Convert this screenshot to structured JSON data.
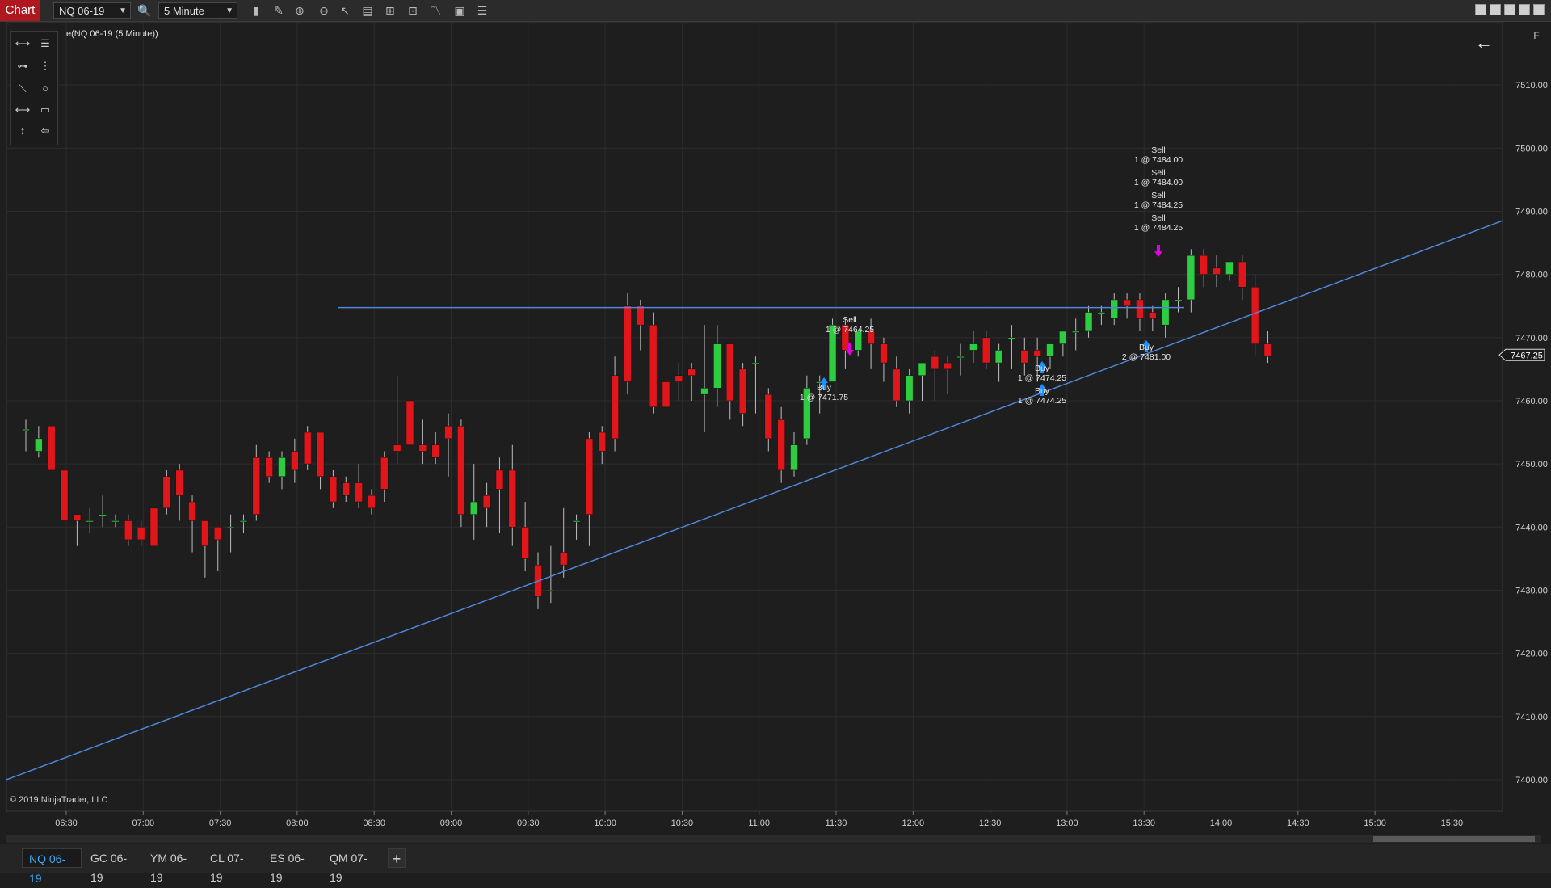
{
  "toolbar": {
    "chart_label": "Chart",
    "instrument": "NQ 06-19",
    "interval": "5 Minute",
    "icons": [
      "search-icon",
      "bars-icon",
      "pencil-icon",
      "zoom-in-icon",
      "zoom-out-icon",
      "pointer-icon",
      "data-box-icon",
      "properties-icon",
      "indicators-icon",
      "strategies-icon",
      "templates-icon",
      "list-icon"
    ]
  },
  "chart": {
    "title": "e(NQ 06-19 (5 Minute))",
    "copyright": "© 2019 NinjaTrader, LLC",
    "last_price_label": "7467.25",
    "f_label": "F"
  },
  "chart_data": {
    "type": "candlestick",
    "ylim": [
      7395,
      7520
    ],
    "yticks": [
      "7400.00",
      "7410.00",
      "7420.00",
      "7430.00",
      "7440.00",
      "7450.00",
      "7460.00",
      "7470.00",
      "7480.00",
      "7490.00",
      "7500.00",
      "7510.00"
    ],
    "yticks_values": [
      7400,
      7410,
      7420,
      7430,
      7440,
      7450,
      7460,
      7470,
      7480,
      7490,
      7500,
      7510
    ],
    "xticks": [
      "06:30",
      "07:00",
      "07:30",
      "08:00",
      "08:30",
      "09:00",
      "09:30",
      "10:00",
      "10:30",
      "11:00",
      "11:30",
      "12:00",
      "12:30",
      "13:00",
      "13:30",
      "14:00",
      "14:30",
      "15:00",
      "15:30"
    ],
    "bars": [
      [
        7455.5,
        7457,
        7455.5,
        7452
      ],
      [
        7452,
        7456,
        7454,
        7451
      ],
      [
        7456,
        7456,
        7449,
        7451
      ],
      [
        7449,
        7449,
        7441,
        7442
      ],
      [
        7442,
        7442,
        7441,
        7437
      ],
      [
        7441,
        7443,
        7441,
        7439
      ],
      [
        7442,
        7445,
        7442,
        7440
      ],
      [
        7441,
        7442,
        7441,
        7440
      ],
      [
        7441,
        7442,
        7438,
        7437
      ],
      [
        7440,
        7441,
        7438,
        7437
      ],
      [
        7443,
        7443,
        7437,
        7437
      ],
      [
        7448,
        7449,
        7443,
        7442
      ],
      [
        7449,
        7450,
        7445,
        7441
      ],
      [
        7444,
        7445,
        7441,
        7436
      ],
      [
        7441,
        7441,
        7437,
        7432
      ],
      [
        7440,
        7440,
        7438,
        7433
      ],
      [
        7440,
        7442,
        7440,
        7436
      ],
      [
        7441,
        7442,
        7441,
        7439
      ],
      [
        7451,
        7453,
        7442,
        7441
      ],
      [
        7451,
        7452,
        7448,
        7447
      ],
      [
        7448,
        7452,
        7451,
        7446
      ],
      [
        7452,
        7454,
        7449,
        7447
      ],
      [
        7455,
        7456,
        7450,
        7449
      ],
      [
        7455,
        7455,
        7448,
        7446
      ],
      [
        7448,
        7449,
        7444,
        7443
      ],
      [
        7447,
        7448,
        7445,
        7444
      ],
      [
        7447,
        7450,
        7444,
        7443
      ],
      [
        7445,
        7446,
        7443,
        7442
      ],
      [
        7451,
        7452,
        7446,
        7444
      ],
      [
        7453,
        7464,
        7452,
        7450
      ],
      [
        7460,
        7465,
        7453,
        7449
      ],
      [
        7453,
        7457,
        7452,
        7450
      ],
      [
        7453,
        7455,
        7451,
        7450
      ],
      [
        7456,
        7458,
        7454,
        7448
      ],
      [
        7456,
        7457,
        7442,
        7440
      ],
      [
        7442,
        7450,
        7444,
        7438
      ],
      [
        7445,
        7447,
        7443,
        7440
      ],
      [
        7449,
        7451,
        7446,
        7439
      ],
      [
        7449,
        7453,
        7440,
        7437
      ],
      [
        7440,
        7444,
        7435,
        7433
      ],
      [
        7434,
        7436,
        7429,
        7427
      ],
      [
        7430,
        7437,
        7430,
        7428
      ],
      [
        7436,
        7443,
        7434,
        7432
      ],
      [
        7441,
        7442,
        7441,
        7438
      ],
      [
        7454,
        7455,
        7442,
        7437
      ],
      [
        7455,
        7456,
        7452,
        7450
      ],
      [
        7464,
        7467,
        7454,
        7452
      ],
      [
        7475,
        7477,
        7463,
        7461
      ],
      [
        7475,
        7476,
        7472,
        7468
      ],
      [
        7472,
        7474,
        7459,
        7458
      ],
      [
        7463,
        7467,
        7459,
        7458
      ],
      [
        7464,
        7466,
        7463,
        7460
      ],
      [
        7465,
        7466,
        7464,
        7460
      ],
      [
        7461,
        7472,
        7462,
        7455
      ],
      [
        7462,
        7472,
        7469,
        7459
      ],
      [
        7469,
        7469,
        7460,
        7457
      ],
      [
        7465,
        7466,
        7458,
        7456
      ],
      [
        7466,
        7467,
        7466,
        7458
      ],
      [
        7461,
        7462,
        7454,
        7452
      ],
      [
        7457,
        7459,
        7449,
        7447
      ],
      [
        7449,
        7455,
        7453,
        7448
      ],
      [
        7454,
        7464,
        7462,
        7453
      ],
      [
        7463,
        7464,
        7463,
        7458
      ],
      [
        7463,
        7473,
        7472,
        7463
      ],
      [
        7472,
        7473,
        7468,
        7465
      ],
      [
        7468,
        7470,
        7471,
        7467
      ],
      [
        7471,
        7473,
        7469,
        7465
      ],
      [
        7469,
        7470,
        7466,
        7463
      ],
      [
        7465,
        7467,
        7460,
        7459
      ],
      [
        7460,
        7465,
        7464,
        7458
      ],
      [
        7464,
        7466,
        7466,
        7460
      ],
      [
        7467,
        7468,
        7465,
        7460
      ],
      [
        7466,
        7467,
        7465,
        7461
      ],
      [
        7467,
        7469,
        7467,
        7464
      ],
      [
        7468,
        7471,
        7469,
        7466
      ],
      [
        7470,
        7471,
        7466,
        7465
      ],
      [
        7466,
        7469,
        7468,
        7463
      ],
      [
        7470,
        7472,
        7470,
        7465
      ],
      [
        7468,
        7470,
        7466,
        7464
      ],
      [
        7468,
        7470,
        7467,
        7463
      ],
      [
        7467,
        7469,
        7469,
        7465
      ],
      [
        7469,
        7470,
        7471,
        7467
      ],
      [
        7471,
        7473,
        7471,
        7468
      ],
      [
        7471,
        7475,
        7474,
        7470
      ],
      [
        7474,
        7475,
        7474,
        7472
      ],
      [
        7473,
        7477,
        7476,
        7472
      ],
      [
        7476,
        7477,
        7475,
        7473
      ],
      [
        7476,
        7477,
        7473,
        7471
      ],
      [
        7474,
        7475,
        7473,
        7471
      ],
      [
        7472,
        7477,
        7476,
        7470
      ],
      [
        7476,
        7478,
        7476,
        7474
      ],
      [
        7476,
        7484,
        7483,
        7474
      ],
      [
        7483,
        7484,
        7480,
        7478
      ],
      [
        7481,
        7483,
        7480,
        7478
      ],
      [
        7480,
        7482,
        7482,
        7479
      ],
      [
        7482,
        7483,
        7478,
        7476
      ],
      [
        7478,
        7480,
        7469,
        7467
      ],
      [
        7469,
        7471,
        7467,
        7466
      ]
    ],
    "horizontal_line": {
      "value": 7474.75
    },
    "trend_line": {
      "from": [
        0,
        7400
      ],
      "to": [
        1,
        7488.5
      ]
    },
    "executions": [
      {
        "type": "Sell",
        "label": "Sell",
        "price": "1 @ 7464.25"
      },
      {
        "type": "Buy",
        "label": "Buy",
        "price": "1 @ 7471.75"
      },
      {
        "type": "Buy",
        "label": "Buy",
        "price": "1 @ 7474.25"
      },
      {
        "type": "Buy",
        "label": "Buy",
        "price": "1 @ 7474.25"
      },
      {
        "type": "Buy",
        "label": "Buy",
        "price": "2 @ 7481.00"
      },
      {
        "type": "Sell",
        "label": "Sell",
        "price": "1 @ 7484.00"
      },
      {
        "type": "Sell",
        "label": "Sell",
        "price": "1 @ 7484.00"
      },
      {
        "type": "Sell",
        "label": "Sell",
        "price": "1 @ 7484.25"
      },
      {
        "type": "Sell",
        "label": "Sell",
        "price": "1 @ 7484.25"
      }
    ],
    "colors": {
      "up": "#2ecc40",
      "down": "#e0161b",
      "trend": "#4f86d9",
      "buy_arrow": "#1e90ff",
      "sell_arrow": "#e000e0",
      "grid": "#2c2c2c"
    }
  },
  "tabs": [
    {
      "label": "NQ 06-19",
      "active": true
    },
    {
      "label": "GC 06-19",
      "active": false
    },
    {
      "label": "YM 06-19",
      "active": false
    },
    {
      "label": "CL 07-19",
      "active": false
    },
    {
      "label": "ES 06-19",
      "active": false
    },
    {
      "label": "QM 07-19",
      "active": false
    }
  ],
  "tab_add_label": "+"
}
